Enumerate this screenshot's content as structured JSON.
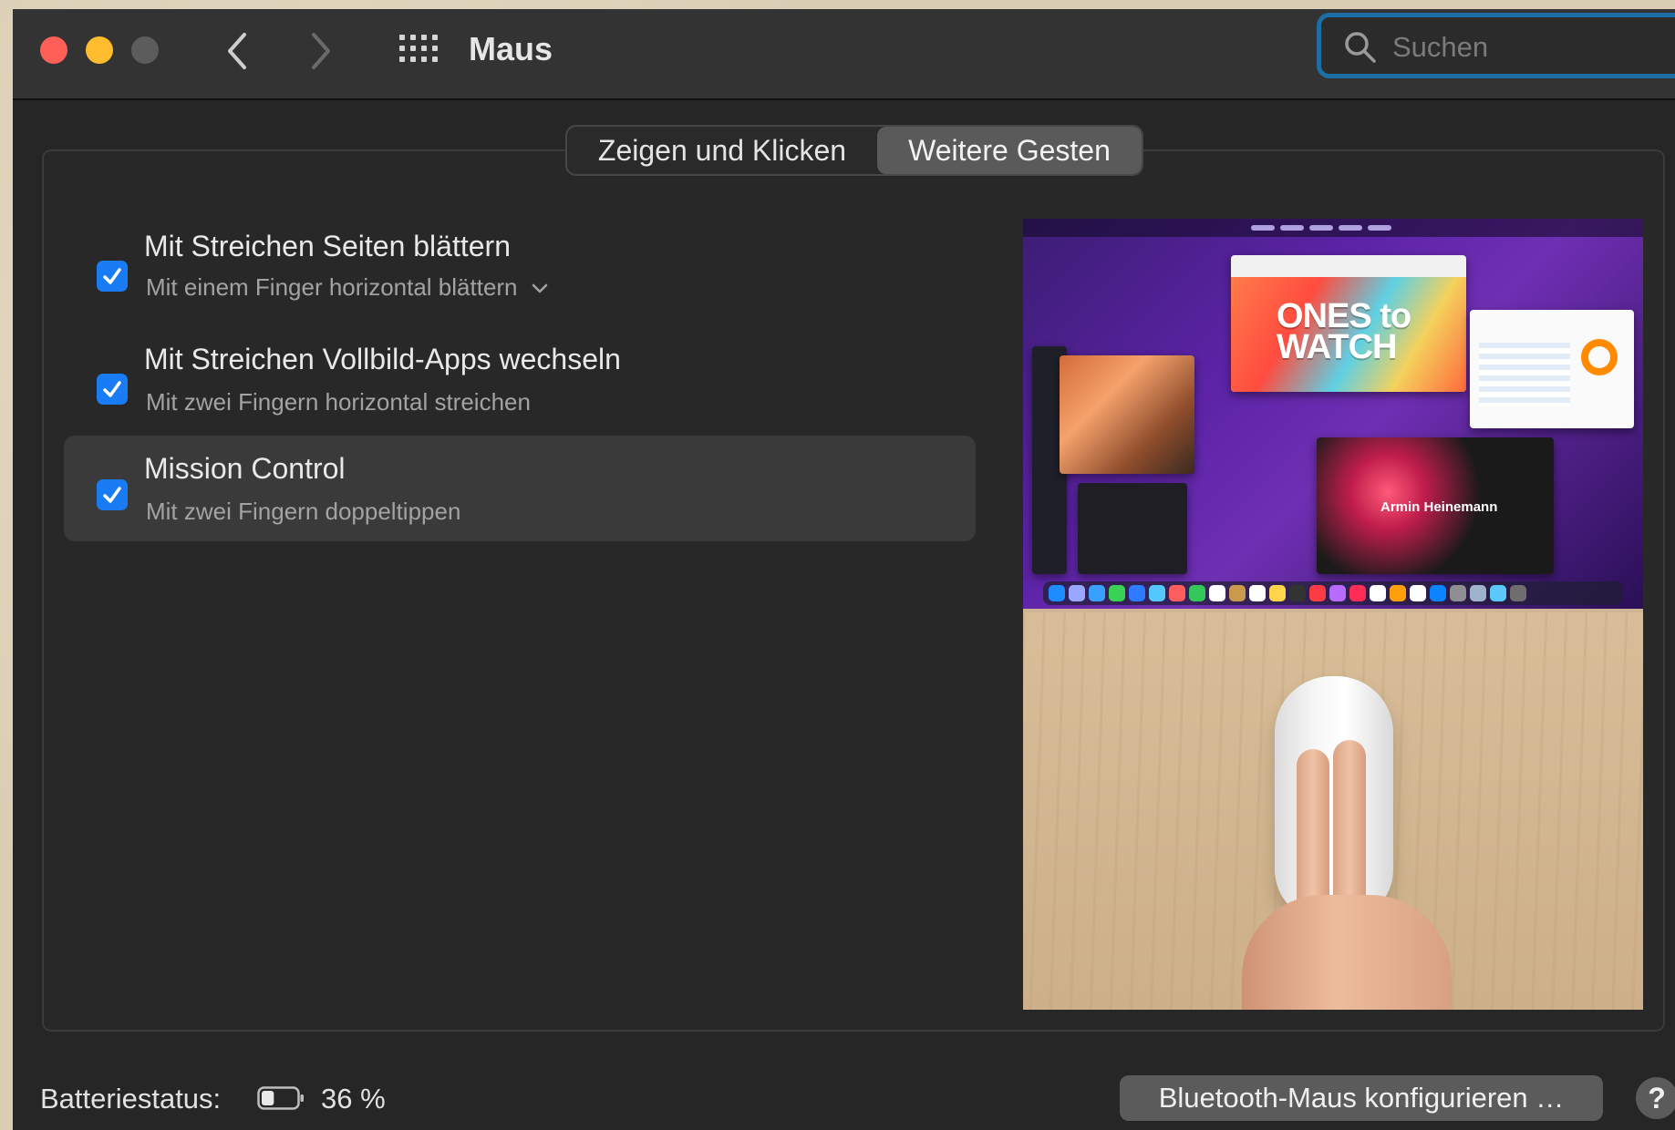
{
  "window": {
    "title": "Maus"
  },
  "search": {
    "placeholder": "Suchen"
  },
  "tabs": [
    {
      "label": "Zeigen und Klicken",
      "selected": false
    },
    {
      "label": "Weitere Gesten",
      "selected": true
    }
  ],
  "gestures": [
    {
      "title": "Mit Streichen Seiten blättern",
      "subtitle": "Mit einem Finger horizontal blättern",
      "checked": true,
      "has_dropdown": true
    },
    {
      "title": "Mit Streichen Vollbild-Apps wechseln",
      "subtitle": "Mit zwei Fingern horizontal streichen",
      "checked": true,
      "has_dropdown": false
    },
    {
      "title": "Mission Control",
      "subtitle": "Mit zwei Fingern doppeltippen",
      "checked": true,
      "has_dropdown": false,
      "selected": true
    }
  ],
  "preview": {
    "tv_text": "ONES to WATCH",
    "music_artist": "Armin Heinemann"
  },
  "footer": {
    "battery_label": "Batteriestatus:",
    "battery_percent": "36 %",
    "battery_level": 0.36,
    "bluetooth_button": "Bluetooth-Maus konfigurieren …",
    "help_label": "?"
  },
  "colors": {
    "accent": "#1a7cf5",
    "search_ring": "#1b6ea6",
    "close": "#fe5f57",
    "minimize": "#febc2e",
    "zoom_disabled": "#5c5c5c"
  },
  "icons": [
    "back-chevron-icon",
    "forward-chevron-icon",
    "grid-icon",
    "search-icon",
    "checkmark-icon",
    "chevron-down-icon",
    "battery-icon"
  ]
}
